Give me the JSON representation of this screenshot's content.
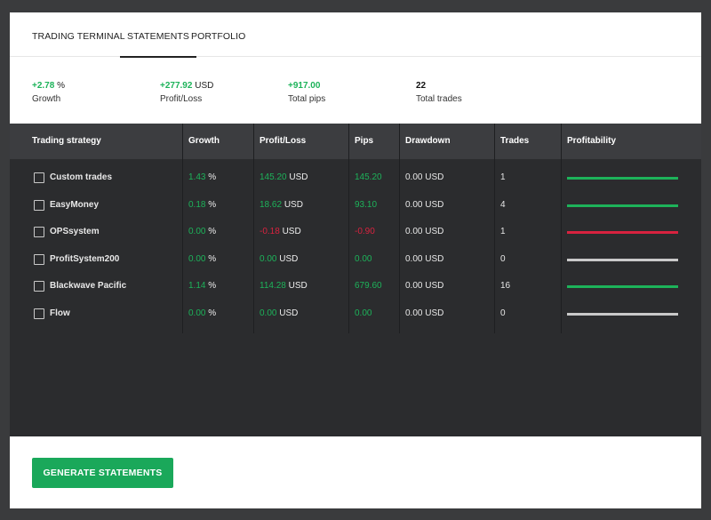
{
  "tabs": [
    {
      "label": "TRADING TERMINAL"
    },
    {
      "label": "STATEMENTS"
    },
    {
      "label": "PORTFOLIO"
    }
  ],
  "summary": {
    "growth": {
      "value": "+2.78",
      "unit": "%",
      "label": "Growth"
    },
    "profit_loss": {
      "value": "+277.92",
      "unit": "USD",
      "label": "Profit/Loss"
    },
    "total_pips": {
      "value": "+917.00",
      "label": "Total pips"
    },
    "total_trades": {
      "value": "22",
      "label": "Total trades"
    }
  },
  "table": {
    "headers": {
      "strategy": "Trading strategy",
      "growth": "Growth",
      "profit_loss": "Profit/Loss",
      "pips": "Pips",
      "drawdown": "Drawdown",
      "trades": "Trades",
      "profitability": "Profitability"
    },
    "rows": [
      {
        "name": "Custom trades",
        "growth": "1.43",
        "growth_unit": "%",
        "profit": "145.20",
        "profit_unit": "USD",
        "pips": "145.20",
        "drawdown": "0.00 USD",
        "trades": "1",
        "profitability": "positive"
      },
      {
        "name": "EasyMoney",
        "growth": "0.18",
        "growth_unit": "%",
        "profit": "18.62",
        "profit_unit": "USD",
        "pips": "93.10",
        "drawdown": "0.00 USD",
        "trades": "4",
        "profitability": "positive"
      },
      {
        "name": "OPSsystem",
        "growth": "0.00",
        "growth_unit": "%",
        "profit": "-0.18",
        "profit_unit": "USD",
        "pips": "-0.90",
        "drawdown": "0.00 USD",
        "trades": "1",
        "profitability": "negative"
      },
      {
        "name": "ProfitSystem200",
        "growth": "0.00",
        "growth_unit": "%",
        "profit": "0.00",
        "profit_unit": "USD",
        "pips": "0.00",
        "drawdown": "0.00 USD",
        "trades": "0",
        "profitability": "neutral"
      },
      {
        "name": "Blackwave Pacific",
        "growth": "1.14",
        "growth_unit": "%",
        "profit": "114.28",
        "profit_unit": "USD",
        "pips": "679.60",
        "drawdown": "0.00 USD",
        "trades": "16",
        "profitability": "positive"
      },
      {
        "name": "Flow",
        "growth": "0.00",
        "growth_unit": "%",
        "profit": "0.00",
        "profit_unit": "USD",
        "pips": "0.00",
        "drawdown": "0.00 USD",
        "trades": "0",
        "profitability": "neutral"
      }
    ]
  },
  "actions": {
    "generate_label": "GENERATE STATEMENTS"
  },
  "colors": {
    "positive": "#1db35a",
    "negative": "#d8223f",
    "neutral": "#c9c9c9",
    "button": "#1aa85a"
  }
}
